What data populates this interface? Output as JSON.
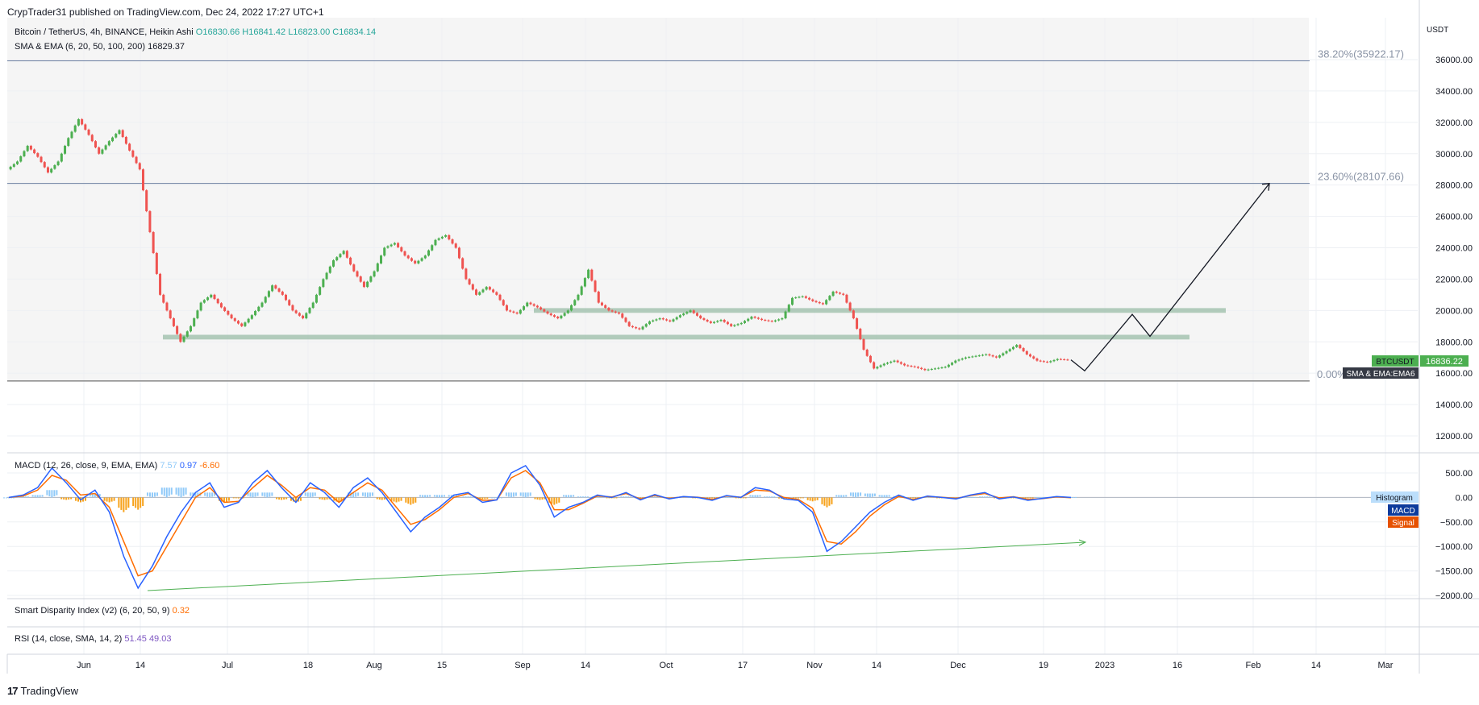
{
  "header": {
    "published": "CrypTrader31 published on TradingView.com, Dec 24, 2022 17:27 UTC+1"
  },
  "legend": {
    "symbol": "Bitcoin / TetherUS, 4h, BINANCE, Heikin Ashi",
    "open": "O16830.66",
    "high": "H16841.42",
    "low": "L16823.00",
    "close": "C16834.14",
    "ma": "SMA & EMA (6, 20, 50, 100, 200)",
    "ma_value": "16829.37"
  },
  "macd_legend": {
    "label": "MACD (12, 26, close, 9, EMA, EMA)",
    "hist": "7.57",
    "macd": "0.97",
    "signal": "-6.60"
  },
  "sdi_legend": {
    "label": "Smart Disparity Index (v2) (6, 20, 50, 9)",
    "value": "0.32"
  },
  "rsi_legend": {
    "label": "RSI (14, close, SMA, 14, 2)",
    "v1": "51.45",
    "v2": "49.03"
  },
  "brand": {
    "name": "TradingView",
    "mark": "17"
  },
  "colors": {
    "up": "#4caf50",
    "down": "#ef5350",
    "zone": "#a5c3b0",
    "histUp": "#90caf9",
    "histDown": "#f7a21b",
    "macd": "#2962ff",
    "signal": "#ff6d00",
    "fib": "#8a94a6",
    "trend": "#4caf50",
    "projection": "#131722"
  },
  "chart_data": [
    {
      "type": "line",
      "title": "Bitcoin / TetherUS, 4h, BINANCE, Heikin Ashi",
      "ylabel": "USDT",
      "ylim": [
        11000,
        37000
      ],
      "yticks": [
        12000,
        14000,
        16000,
        18000,
        20000,
        22000,
        24000,
        26000,
        28000,
        30000,
        32000,
        34000,
        36000
      ],
      "xticks": [
        "Jun",
        "14",
        "Jul",
        "18",
        "Aug",
        "15",
        "Sep",
        "14",
        "Oct",
        "17",
        "Nov",
        "14",
        "Dec",
        "19",
        "2023",
        "16",
        "Feb",
        "14",
        "Mar"
      ],
      "series": [
        {
          "values": [
            29000,
            29500,
            30500,
            29800,
            28800,
            29500,
            31000,
            32200,
            31200,
            30000,
            30800,
            31500,
            30200,
            29000,
            25000,
            21000,
            19500,
            18000,
            19000,
            20500,
            21000,
            20200,
            19500,
            19000,
            19700,
            20500,
            21600,
            21000,
            20000,
            19500,
            20500,
            22000,
            23200,
            23800,
            22500,
            21500,
            22500,
            24000,
            24300,
            23500,
            23000,
            23500,
            24500,
            24800,
            24000,
            22000,
            21000,
            21500,
            21000,
            20000,
            19800,
            20500,
            20200,
            19800,
            19500,
            20000,
            21000,
            22600,
            20500,
            20000,
            19800,
            19000,
            18800,
            19300,
            19500,
            19300,
            19700,
            20000,
            19500,
            19200,
            19400,
            19000,
            19200,
            19600,
            19400,
            19300,
            19500,
            20800,
            20900,
            20600,
            20400,
            21200,
            21000,
            19500,
            17500,
            16300,
            16600,
            16800,
            16500,
            16400,
            16200,
            16300,
            16400,
            16800,
            17000,
            17100,
            17200,
            17000,
            17400,
            17800,
            17200,
            16800,
            16700,
            16900,
            16850
          ]
        }
      ],
      "fib_levels": [
        {
          "label": "38.20%(35922.17)",
          "value": 35922.17
        },
        {
          "label": "23.60%(28107.66)",
          "value": 28107.66
        },
        {
          "label": "0.00%",
          "value": 15500
        }
      ],
      "zones": [
        [
          18150,
          18450
        ],
        [
          19850,
          20150
        ]
      ],
      "projection": [
        [
          16850,
          16150
        ],
        [
          19750,
          18350
        ],
        [
          28100
        ]
      ],
      "price_label": {
        "symbol": "BTCUSDT",
        "value": "16836.22",
        "ema_label": "SMA & EMA:EMA6"
      }
    },
    {
      "type": "line",
      "title": "MACD (12, 26, close, 9, EMA, EMA)",
      "ylim": [
        -2150,
        750
      ],
      "yticks": [
        500,
        0,
        -500,
        -1000,
        -1500,
        -2000
      ],
      "ytick_labels": [
        "500.00",
        "0.00",
        "−500.00",
        "−1000.00",
        "−1500.00",
        "−2000.00"
      ],
      "series": [
        {
          "name": "MACD",
          "values": [
            0,
            50,
            200,
            600,
            300,
            -50,
            150,
            -300,
            -1200,
            -1850,
            -1400,
            -800,
            -300,
            100,
            300,
            -200,
            -100,
            300,
            550,
            200,
            -100,
            300,
            100,
            -200,
            200,
            400,
            100,
            -300,
            -700,
            -400,
            -200,
            50,
            100,
            -100,
            -50,
            500,
            650,
            250,
            -400,
            -200,
            -100,
            50,
            0,
            100,
            -50,
            60,
            -30,
            20,
            0,
            -60,
            40,
            0,
            200,
            150,
            -30,
            -60,
            -300,
            -1100,
            -900,
            -600,
            -300,
            -100,
            50,
            -60,
            30,
            0,
            -30,
            50,
            100,
            -30,
            10,
            -60,
            -20,
            20,
            0
          ]
        },
        {
          "name": "Signal",
          "values": [
            0,
            30,
            150,
            450,
            350,
            50,
            80,
            -200,
            -900,
            -1600,
            -1500,
            -1000,
            -500,
            0,
            200,
            -100,
            -80,
            200,
            450,
            250,
            0,
            200,
            150,
            -100,
            100,
            300,
            150,
            -200,
            -550,
            -450,
            -250,
            0,
            80,
            -60,
            -50,
            400,
            550,
            300,
            -250,
            -250,
            -120,
            30,
            10,
            80,
            -30,
            40,
            -20,
            15,
            5,
            -40,
            30,
            5,
            150,
            130,
            0,
            -40,
            -220,
            -900,
            -950,
            -700,
            -380,
            -150,
            20,
            -40,
            20,
            5,
            -20,
            40,
            80,
            -10,
            15,
            -40,
            -25,
            10,
            -7
          ]
        },
        {
          "name": "Histogram",
          "values": [
            0,
            20,
            50,
            150,
            -50,
            -100,
            70,
            -100,
            -300,
            -250,
            100,
            200,
            200,
            100,
            100,
            -100,
            -20,
            100,
            100,
            -50,
            -100,
            100,
            -50,
            -100,
            100,
            100,
            -50,
            -100,
            -150,
            50,
            50,
            50,
            20,
            -40,
            0,
            100,
            100,
            -50,
            -150,
            50,
            20,
            20,
            -10,
            20,
            -20,
            20,
            -10,
            5,
            -5,
            -20,
            10,
            -5,
            50,
            20,
            -30,
            -20,
            -80,
            -200,
            50,
            100,
            80,
            50,
            30,
            -20,
            10,
            -5,
            -10,
            10,
            20,
            -20,
            -5,
            -20,
            5,
            10,
            7.57
          ]
        }
      ],
      "price_labels": {
        "histogram": "Histogram",
        "macd": "MACD",
        "signal": "Signal"
      }
    }
  ]
}
